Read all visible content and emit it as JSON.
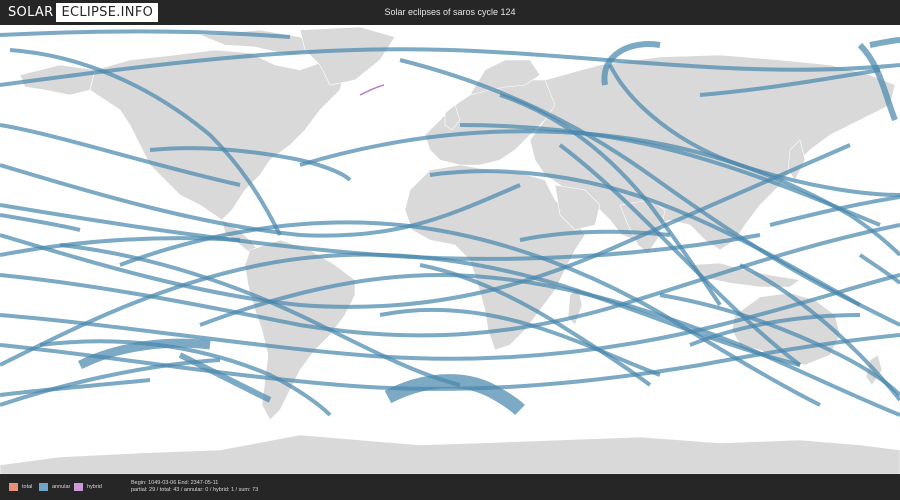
{
  "header": {
    "logo_part1": "SOLAR",
    "logo_part2": "ECLIPSE.INFO",
    "title": "Solar eclipses of saros cycle 124"
  },
  "legend": {
    "items": [
      {
        "label": "total",
        "color": "#e8907a"
      },
      {
        "label": "annular",
        "color": "#6fa6c9"
      },
      {
        "label": "hybrid",
        "color": "#c99ad6"
      }
    ]
  },
  "stats": {
    "line1": "Begin: 1049-03-06 End: 2347-05-11",
    "line2": "partial: 29 / total: 43 / annular: 0 / hybrid: 1 / sum: 73"
  },
  "map": {
    "land_color": "#d9d9d9",
    "border_color": "#ffffff",
    "ocean_color": "#ffffff",
    "path_color": "#4a88ad",
    "hybrid_color": "#b77fcc"
  }
}
